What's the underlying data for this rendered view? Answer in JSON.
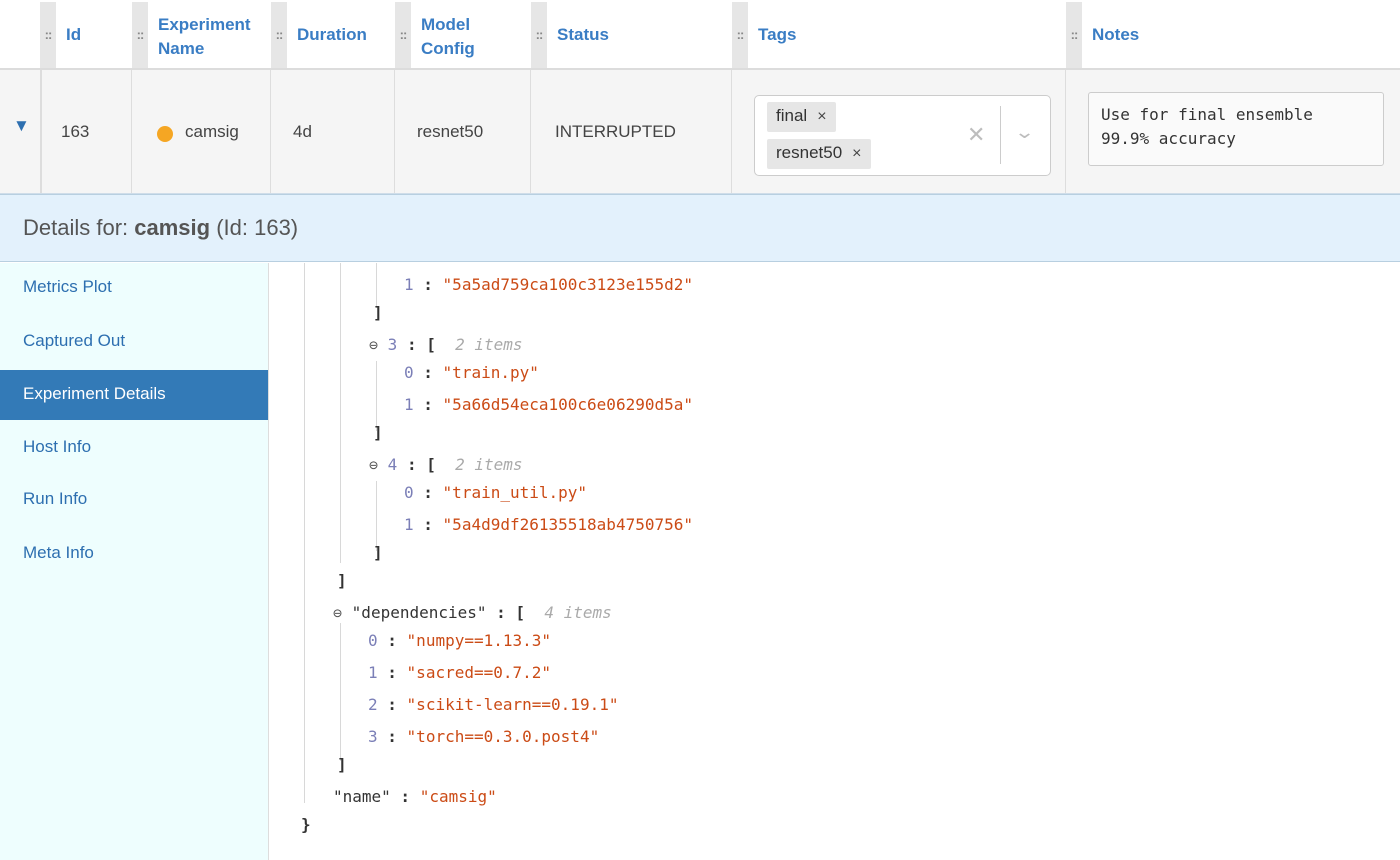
{
  "table": {
    "columns": [
      {
        "id": "col-id",
        "label": "Id"
      },
      {
        "id": "col-name",
        "label": "Experiment Name"
      },
      {
        "id": "col-duration",
        "label": "Duration"
      },
      {
        "id": "col-model",
        "label": "Model Config"
      },
      {
        "id": "col-status",
        "label": "Status"
      },
      {
        "id": "col-tags",
        "label": "Tags"
      },
      {
        "id": "col-notes",
        "label": "Notes"
      }
    ],
    "header_name_line1": "Experiment",
    "header_name_line2": "Name",
    "header_model_line1": "Model",
    "header_model_line2": "Config",
    "row": {
      "id": "163",
      "name": "camsig",
      "duration": "4d",
      "model_config": "resnet50",
      "status": "INTERRUPTED",
      "status_color": "#f5a623",
      "tags": [
        "final",
        "resnet50"
      ],
      "notes": "Use for final ensemble\n99.9% accuracy"
    }
  },
  "details": {
    "prefix": "Details for: ",
    "name": "camsig",
    "suffix": " (Id: 163)"
  },
  "sidebar": {
    "items": [
      {
        "label": "Metrics Plot",
        "active": false
      },
      {
        "label": "Captured Out",
        "active": false
      },
      {
        "label": "Experiment Details",
        "active": true
      },
      {
        "label": "Host Info",
        "active": false
      },
      {
        "label": "Run Info",
        "active": false
      },
      {
        "label": "Meta Info",
        "active": false
      }
    ]
  },
  "json_view": {
    "lines": [
      {
        "idx": "1",
        "str": "\"5a5ad759ca100c3123e155d2\""
      },
      {
        "bracket": "]"
      },
      {
        "idx": "3",
        "count": "2 items"
      },
      {
        "idx": "0",
        "str": "\"train.py\""
      },
      {
        "idx": "1",
        "str": "\"5a66d54eca100c6e06290d5a\""
      },
      {
        "bracket": "]"
      },
      {
        "idx": "4",
        "count": "2 items"
      },
      {
        "idx": "0",
        "str": "\"train_util.py\""
      },
      {
        "idx": "1",
        "str": "\"5a4d9df26135518ab4750756\""
      },
      {
        "bracket": "]"
      },
      {
        "bracket": "]"
      },
      {
        "key": "\"dependencies\"",
        "count": "4 items"
      },
      {
        "idx": "0",
        "str": "\"numpy==1.13.3\""
      },
      {
        "idx": "1",
        "str": "\"sacred==0.7.2\""
      },
      {
        "idx": "2",
        "str": "\"scikit-learn==0.19.1\""
      },
      {
        "idx": "3",
        "str": "\"torch==0.3.0.post4\""
      },
      {
        "bracket": "]"
      },
      {
        "key": "\"name\"",
        "str": "\"camsig\""
      },
      {
        "bracket": "}"
      }
    ]
  },
  "icons": {
    "grip": "drag-handle-icon",
    "expander": "triangle-down-icon",
    "collapse": "minus-circle-icon",
    "tag_remove": "close-icon",
    "clear": "clear-icon",
    "dropdown": "chevron-down-icon"
  },
  "colors": {
    "header_text": "#3a7dc4",
    "active_item_bg": "#337ab7",
    "sidebar_bg": "#eefefe",
    "details_bar_bg": "#e3f1fc",
    "json_string": "#cb4b16",
    "json_index": "#7b7fb7"
  }
}
